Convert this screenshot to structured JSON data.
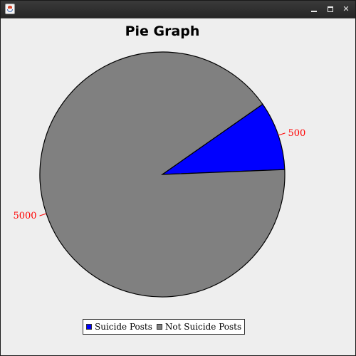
{
  "window": {
    "title": "",
    "controls": [
      "minimize",
      "maximize",
      "close"
    ]
  },
  "chart_data": {
    "type": "pie",
    "title": "Pie Graph",
    "slices": [
      {
        "label": "Suicide Posts",
        "value": 500,
        "color": "#0000ff"
      },
      {
        "label": "Not Suicide Posts",
        "value": 5000,
        "color": "#808080"
      }
    ],
    "label_color": "#ff0000",
    "legend_placement": "bottom"
  }
}
